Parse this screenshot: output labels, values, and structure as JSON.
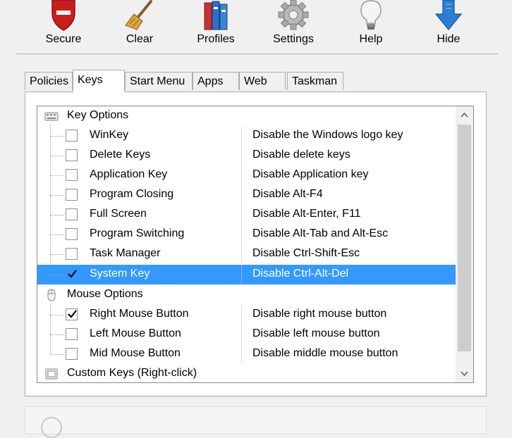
{
  "toolbar": {
    "buttons": [
      {
        "label": "Secure",
        "icon": "shield-icon"
      },
      {
        "label": "Clear",
        "icon": "broom-icon"
      },
      {
        "label": "Profiles",
        "icon": "books-icon"
      },
      {
        "label": "Settings",
        "icon": "gear-icon"
      },
      {
        "label": "Help",
        "icon": "lightbulb-icon"
      },
      {
        "label": "Hide",
        "icon": "down-arrow-icon"
      }
    ]
  },
  "tabs": [
    {
      "label": "Policies"
    },
    {
      "label": "Keys",
      "active": true
    },
    {
      "label": "Start Menu"
    },
    {
      "label": "Apps"
    },
    {
      "label": "Web"
    },
    {
      "label": "Taskman"
    }
  ],
  "tree": {
    "key_options": {
      "label": "Key Options",
      "icon": "keyboard-icon",
      "items": [
        {
          "name": "WinKey",
          "description": "Disable the Windows logo key",
          "checked": false
        },
        {
          "name": "Delete Keys",
          "description": "Disable delete keys",
          "checked": false
        },
        {
          "name": "Application Key",
          "description": "Disable Application key",
          "checked": false
        },
        {
          "name": "Program Closing",
          "description": "Disable Alt-F4",
          "checked": false
        },
        {
          "name": "Full Screen",
          "description": "Disable Alt-Enter, F11",
          "checked": false
        },
        {
          "name": "Program Switching",
          "description": "Disable Alt-Tab and Alt-Esc",
          "checked": false
        },
        {
          "name": "Task Manager",
          "description": "Disable Ctrl-Shift-Esc",
          "checked": false
        },
        {
          "name": "System Key",
          "description": "Disable Ctrl-Alt-Del",
          "checked": true,
          "selected": true
        }
      ]
    },
    "mouse_options": {
      "label": "Mouse Options",
      "icon": "mouse-icon",
      "items": [
        {
          "name": "Right Mouse Button",
          "description": "Disable right mouse button",
          "checked": true
        },
        {
          "name": "Left Mouse Button",
          "description": "Disable left mouse button",
          "checked": false
        },
        {
          "name": "Mid Mouse Button",
          "description": "Disable middle mouse button",
          "checked": false
        }
      ]
    },
    "custom_keys": {
      "label": "Custom Keys (Right-click)",
      "icon": "custom-keys-icon"
    }
  },
  "colors": {
    "selection": "#3399ff",
    "secure_red": "#cc1f1f",
    "hide_blue": "#2a7fd4"
  }
}
